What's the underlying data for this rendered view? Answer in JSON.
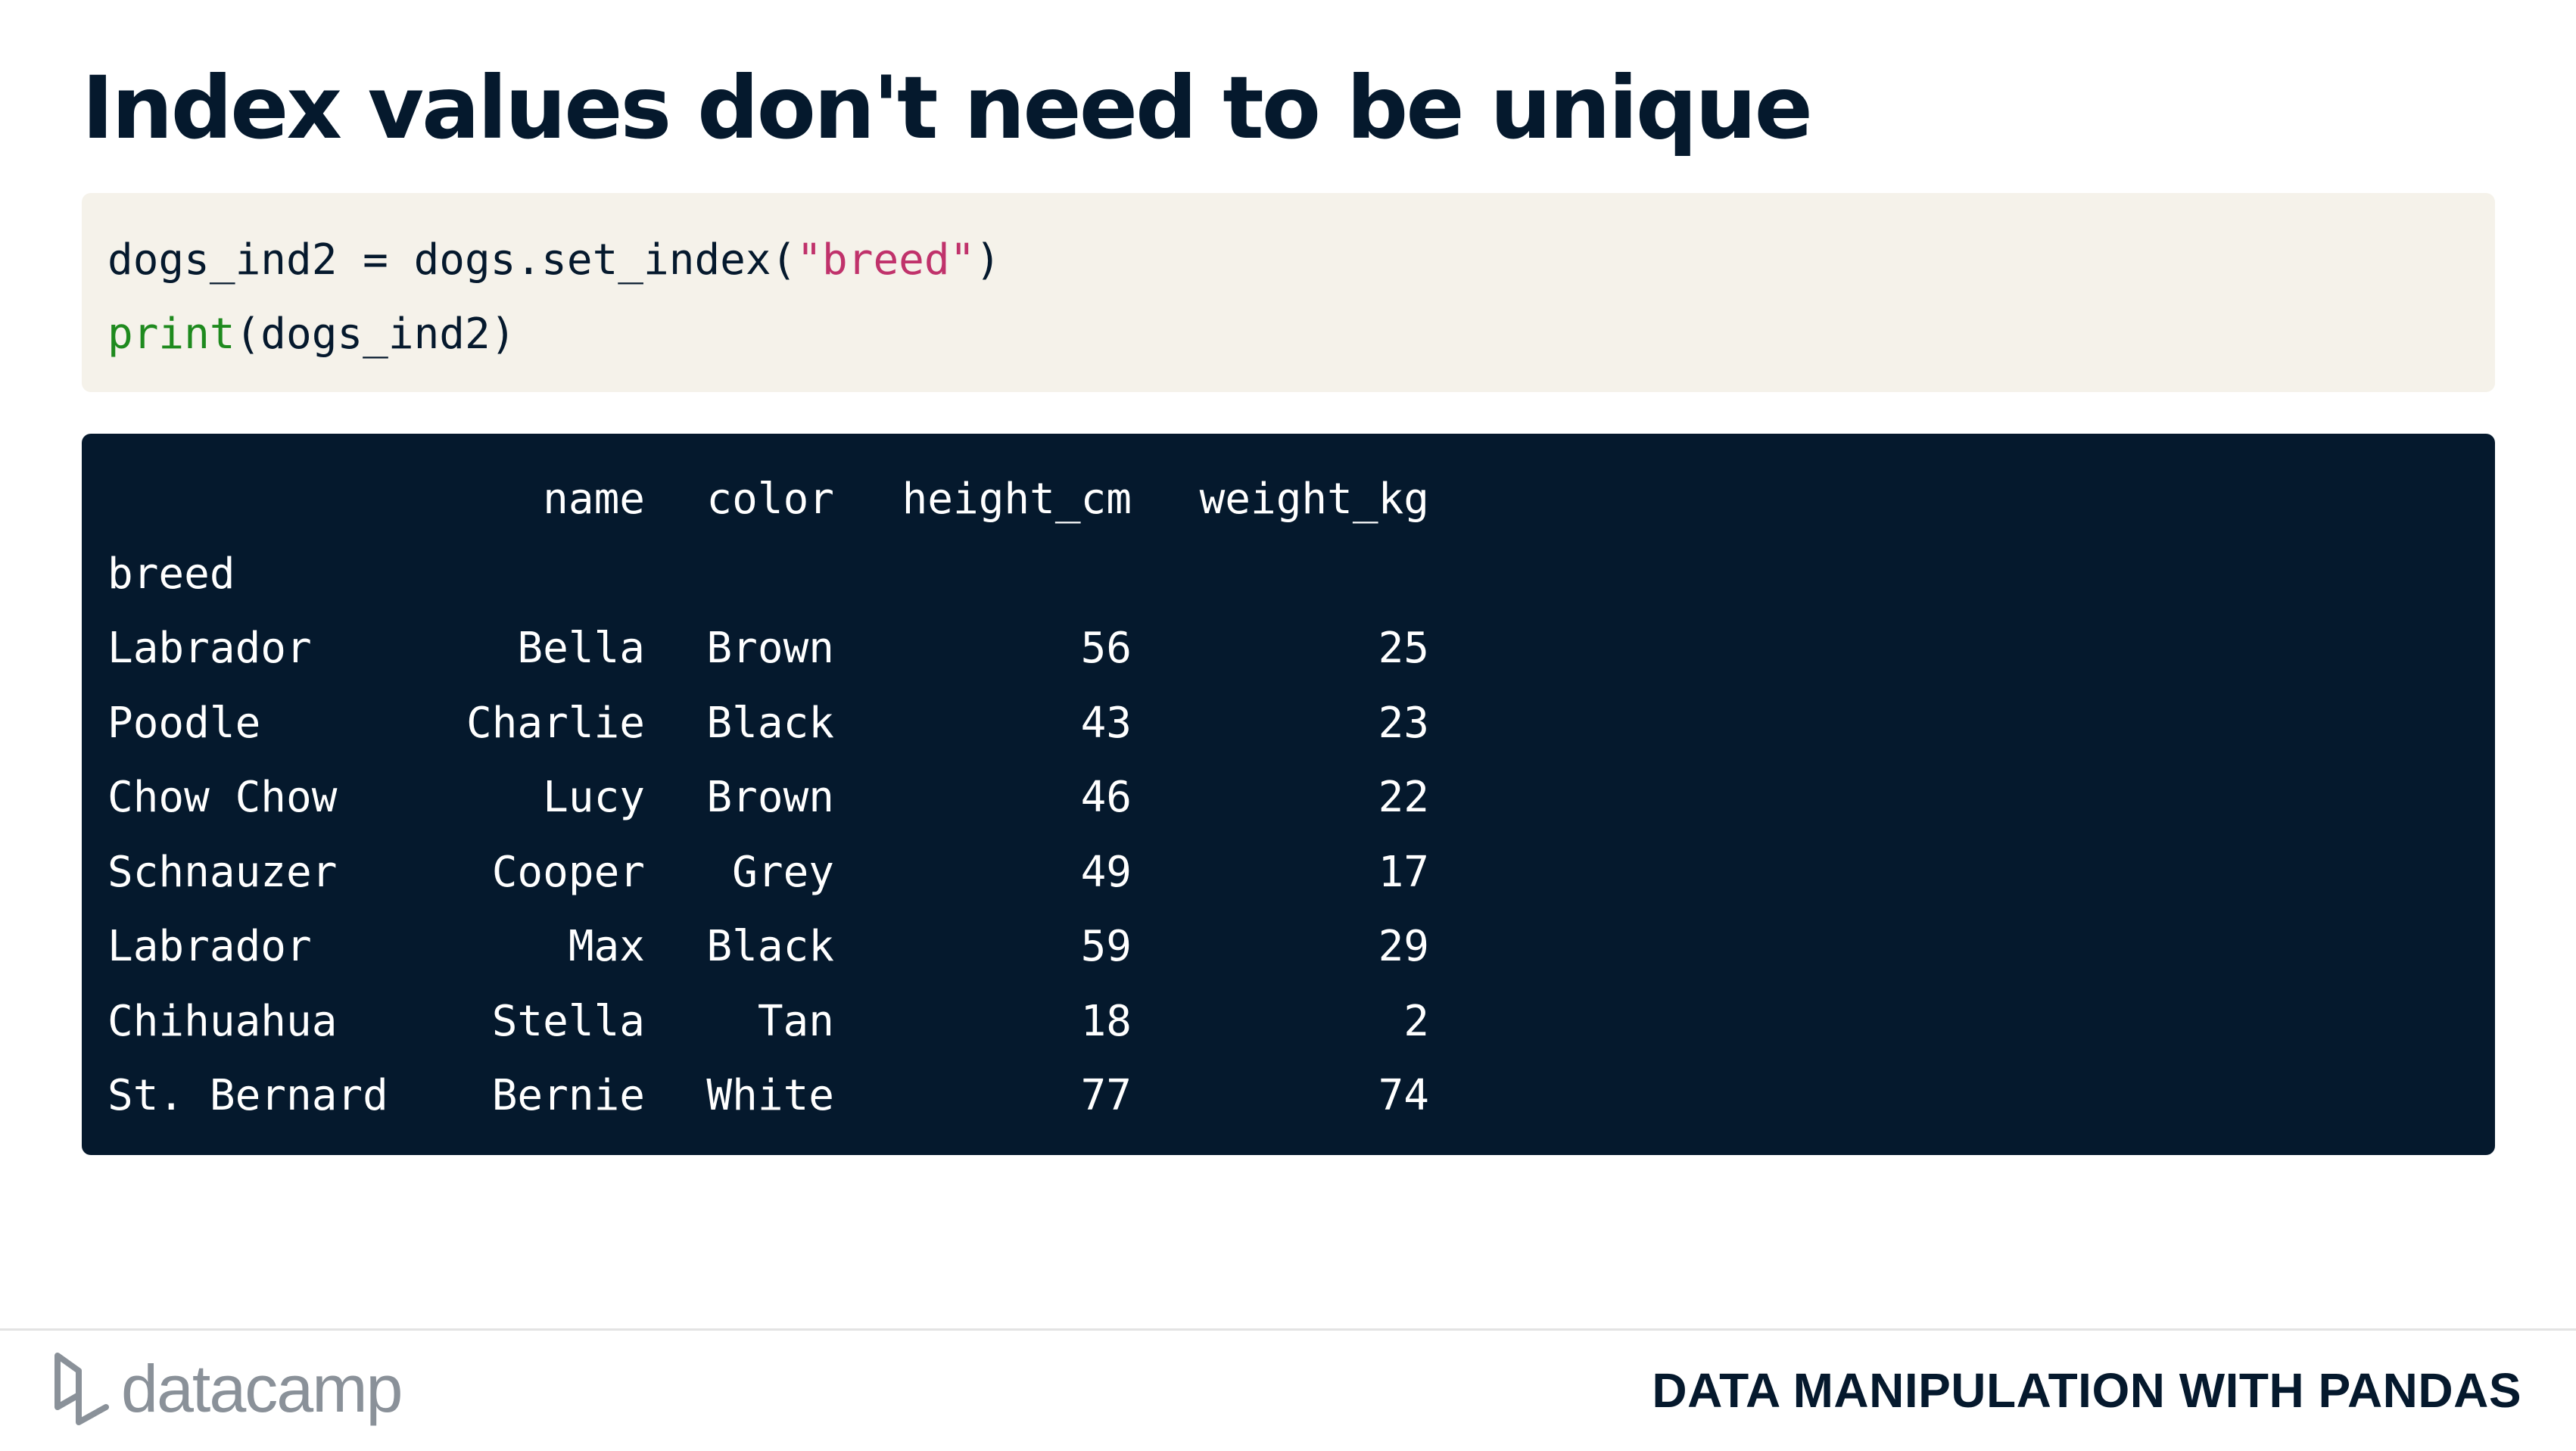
{
  "slide": {
    "title": "Index values don't need to be unique"
  },
  "code": {
    "line1": {
      "pre": "dogs_ind2 = dogs.set_index(",
      "string": "\"breed\"",
      "post": ")"
    },
    "line2": {
      "fn": "print",
      "args": "(dogs_ind2)"
    }
  },
  "output": {
    "columns": [
      "",
      "name",
      "color",
      "height_cm",
      "weight_kg"
    ],
    "index_name": "breed",
    "rows": [
      {
        "breed": "Labrador",
        "name": "Bella",
        "color": "Brown",
        "height_cm": "56",
        "weight_kg": "25"
      },
      {
        "breed": "Poodle",
        "name": "Charlie",
        "color": "Black",
        "height_cm": "43",
        "weight_kg": "23"
      },
      {
        "breed": "Chow Chow",
        "name": "Lucy",
        "color": "Brown",
        "height_cm": "46",
        "weight_kg": "22"
      },
      {
        "breed": "Schnauzer",
        "name": "Cooper",
        "color": "Grey",
        "height_cm": "49",
        "weight_kg": "17"
      },
      {
        "breed": "Labrador",
        "name": "Max",
        "color": "Black",
        "height_cm": "59",
        "weight_kg": "29"
      },
      {
        "breed": "Chihuahua",
        "name": "Stella",
        "color": "Tan",
        "height_cm": "18",
        "weight_kg": "2"
      },
      {
        "breed": "St. Bernard",
        "name": "Bernie",
        "color": "White",
        "height_cm": "77",
        "weight_kg": "74"
      }
    ]
  },
  "footer": {
    "logo_text": "datacamp",
    "logo_icon": "datacamp-logo-icon",
    "course": "DATA MANIPULATION WITH PANDAS"
  },
  "colors": {
    "navy": "#05192d",
    "code_bg": "#f5f2ea",
    "string": "#c0326b",
    "function": "#1e8a1e",
    "logo_grey": "#8a9199"
  }
}
